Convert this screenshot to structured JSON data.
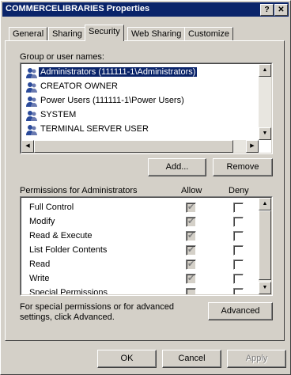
{
  "window": {
    "title": "COMMERCELIBRARIES Properties",
    "help_btn": "?",
    "close_btn": "✕"
  },
  "tabs": [
    {
      "label": "General"
    },
    {
      "label": "Sharing"
    },
    {
      "label": "Security",
      "active": true
    },
    {
      "label": "Web Sharing"
    },
    {
      "label": "Customize"
    }
  ],
  "group_list": {
    "label": "Group or user names:",
    "items": [
      {
        "name": "Administrators (111111-1\\Administrators)",
        "selected": true
      },
      {
        "name": "CREATOR OWNER"
      },
      {
        "name": "Power Users (111111-1\\Power Users)"
      },
      {
        "name": "SYSTEM"
      },
      {
        "name": "TERMINAL SERVER USER"
      }
    ]
  },
  "buttons": {
    "add": "Add...",
    "remove": "Remove",
    "advanced": "Advanced",
    "ok": "OK",
    "cancel": "Cancel",
    "apply": "Apply"
  },
  "permissions": {
    "label": "Permissions for Administrators",
    "allow_header": "Allow",
    "deny_header": "Deny",
    "items": [
      {
        "name": "Full Control",
        "allow": true,
        "deny": false
      },
      {
        "name": "Modify",
        "allow": true,
        "deny": false
      },
      {
        "name": "Read & Execute",
        "allow": true,
        "deny": false
      },
      {
        "name": "List Folder Contents",
        "allow": true,
        "deny": false
      },
      {
        "name": "Read",
        "allow": true,
        "deny": false
      },
      {
        "name": "Write",
        "allow": true,
        "deny": false
      },
      {
        "name": "Special Permissions",
        "allow": false,
        "deny": false
      }
    ]
  },
  "advanced_text": "For special permissions or for advanced settings, click Advanced."
}
